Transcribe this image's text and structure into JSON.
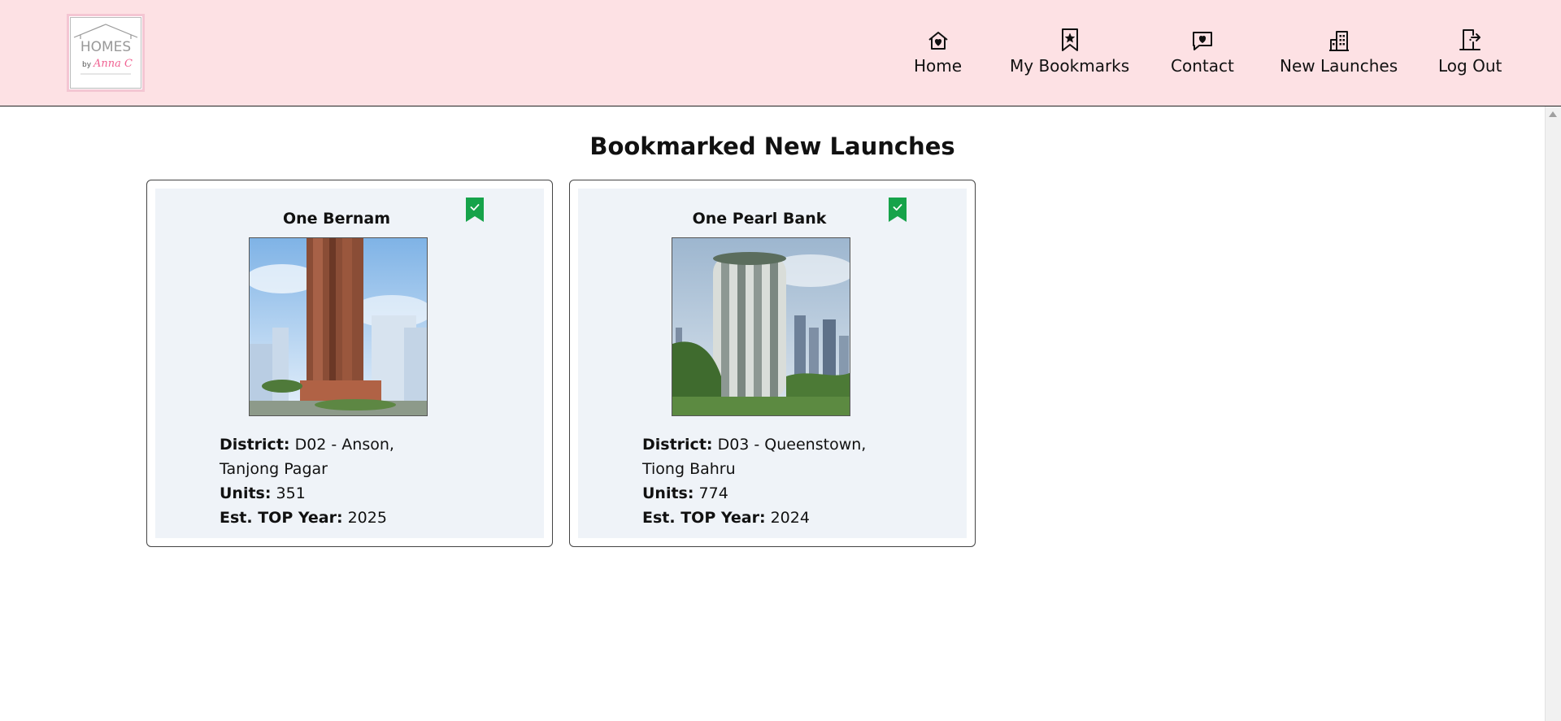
{
  "brand": {
    "logo_top": "HOMES",
    "logo_by": "by",
    "logo_name": "Anna C",
    "accent": "#f48fb1"
  },
  "nav": {
    "items": [
      {
        "label": "Home",
        "icon": "house-heart-icon"
      },
      {
        "label": "My Bookmarks",
        "icon": "bookmark-star-icon"
      },
      {
        "label": "Contact",
        "icon": "chat-heart-icon"
      },
      {
        "label": "New Launches",
        "icon": "buildings-icon"
      },
      {
        "label": "Log Out",
        "icon": "door-exit-icon"
      }
    ],
    "background": "#fde1e4"
  },
  "main": {
    "title": "Bookmarked New Launches",
    "cards": [
      {
        "name": "One Bernam",
        "bookmarked": true,
        "district_label": "District:",
        "district": "D02 - Anson, Tanjong Pagar",
        "units_label": "Units:",
        "units": "351",
        "top_label": "Est. TOP Year:",
        "top_year": "2025",
        "image": "tower-photo-one-bernam"
      },
      {
        "name": "One Pearl Bank",
        "bookmarked": true,
        "district_label": "District:",
        "district": "D03 - Queenstown, Tiong Bahru",
        "units_label": "Units:",
        "units": "774",
        "top_label": "Est. TOP Year:",
        "top_year": "2024",
        "image": "tower-photo-one-pearl-bank"
      }
    ],
    "bookmark_color": "#16a34a",
    "card_bg": "#eff3f8"
  }
}
